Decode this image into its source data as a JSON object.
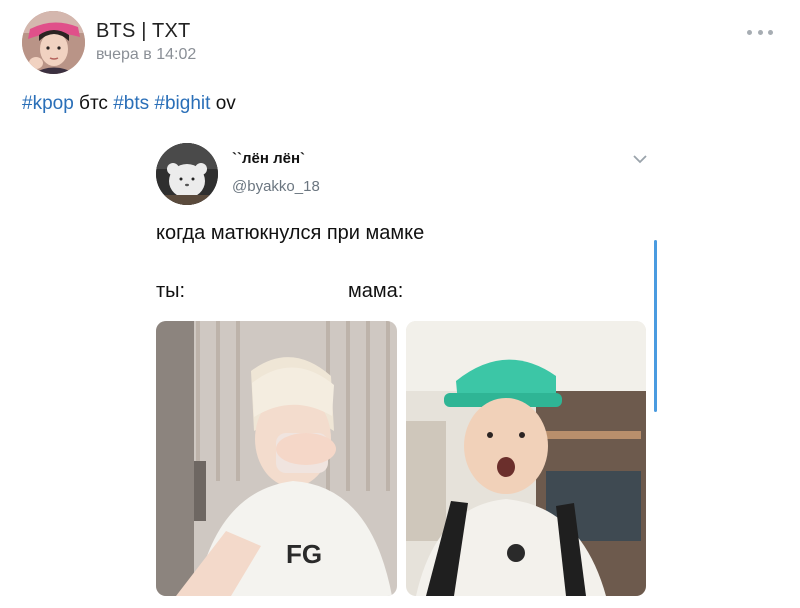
{
  "post": {
    "author": "BTS | TXT",
    "time": "вчера в 14:02",
    "hashtags": [
      {
        "text": "#kpop",
        "link": true
      },
      {
        "text": " бтс ",
        "link": false
      },
      {
        "text": "#bts",
        "link": true
      },
      {
        "text": " ",
        "link": false
      },
      {
        "text": "#bighit",
        "link": true
      },
      {
        "text": " ov",
        "link": false
      }
    ]
  },
  "tweet": {
    "name": "``лён лён`",
    "handle": "@byakko_18",
    "text": "когда матюкнулся при мамке",
    "label_left": "ты:",
    "label_right": "мама:"
  },
  "colors": {
    "link": "#2a6fb8",
    "muted": "#8a8f96",
    "scrollbar": "#4a9be0"
  }
}
